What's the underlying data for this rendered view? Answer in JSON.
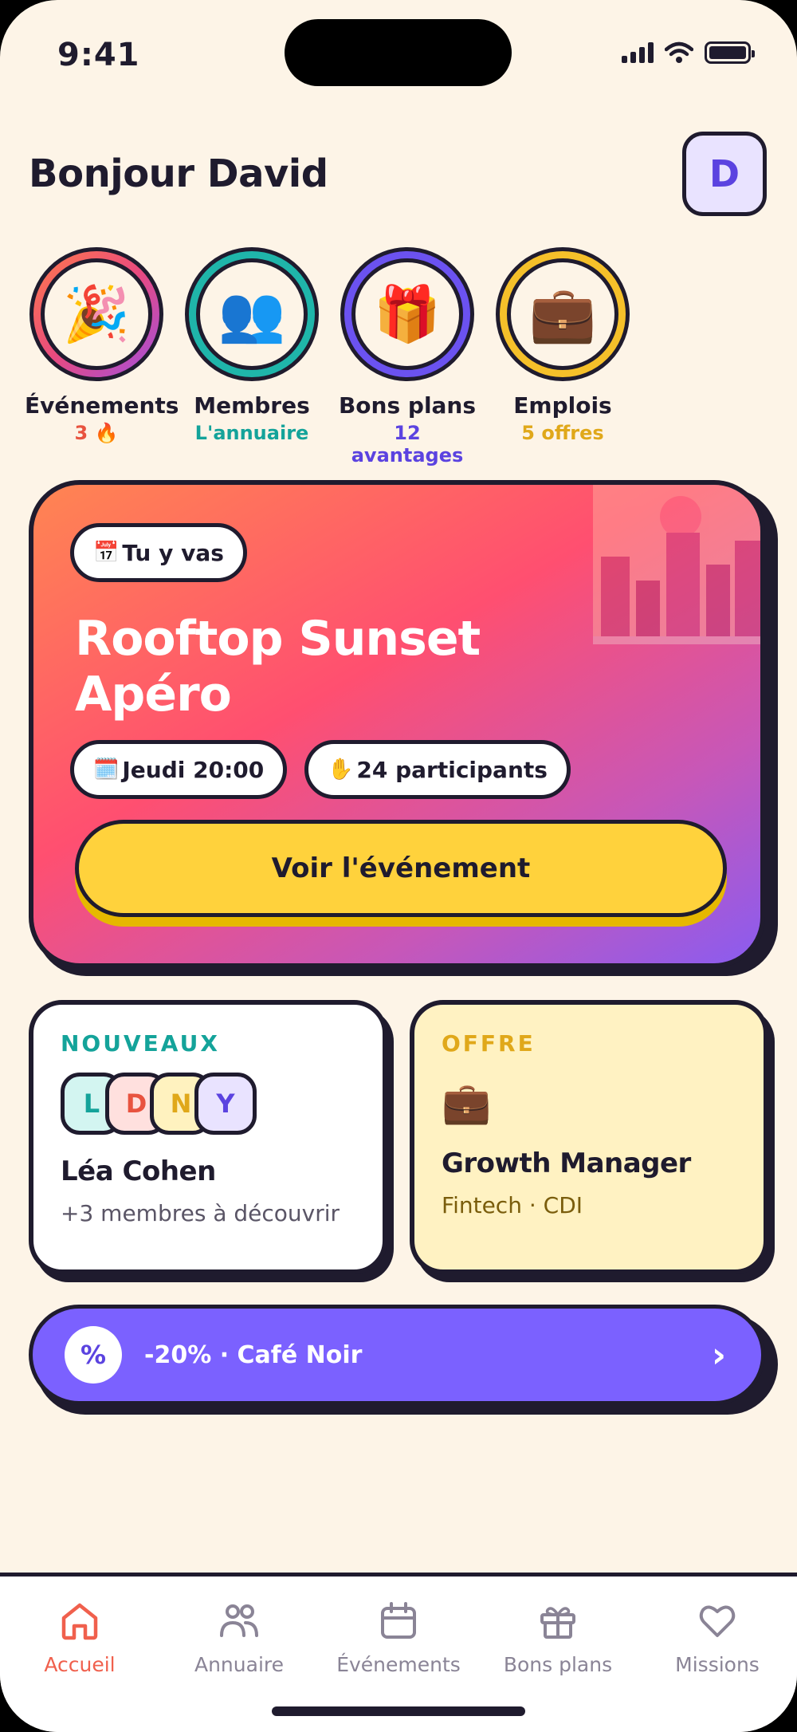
{
  "status": {
    "time": "9:41"
  },
  "header": {
    "greeting": "Bonjour David",
    "avatar_initial": "D"
  },
  "stories": [
    {
      "label": "Événements",
      "sub": "3 🔥",
      "icon": "party-popper",
      "emoji": "🎉",
      "color": "#e8533f"
    },
    {
      "label": "Membres",
      "sub": "L'annuaire",
      "icon": "people",
      "emoji": "👥",
      "color": "#14a39a"
    },
    {
      "label": "Bons plans",
      "sub": "12 avantages",
      "icon": "gift",
      "emoji": "🎁",
      "color": "#5b43e0"
    },
    {
      "label": "Emplois",
      "sub": "5 offres",
      "icon": "briefcase",
      "emoji": "💼",
      "color": "#e0a81a"
    }
  ],
  "hero": {
    "badge": "Tu y vas",
    "badge_emoji": "📅",
    "title_line1": "Rooftop Sunset",
    "title_line2": "Apéro",
    "date": "Jeudi 20:00",
    "date_emoji": "🗓️",
    "participants": "24 participants",
    "participants_emoji": "✋",
    "cta": "Voir l'événement"
  },
  "new_members": {
    "kicker": "NOUVEAUX",
    "initials": [
      "L",
      "D",
      "N",
      "Y"
    ],
    "name": "Léa Cohen",
    "sub": "+3 membres à découvrir"
  },
  "job_offer": {
    "kicker": "OFFRE",
    "emoji": "💼",
    "title": "Growth Manager",
    "sub": "Fintech · CDI"
  },
  "promo": {
    "badge": "%",
    "text": "-20% · Café Noir",
    "arrow": "›"
  },
  "tabbar": {
    "active": "Accueil",
    "items": [
      {
        "label": "Accueil",
        "icon": "home-icon"
      },
      {
        "label": "Annuaire",
        "icon": "people-icon"
      },
      {
        "label": "Événements",
        "icon": "calendar-icon"
      },
      {
        "label": "Bons plans",
        "icon": "gift-icon"
      },
      {
        "label": "Missions",
        "icon": "heart-icon"
      }
    ]
  },
  "colors": {
    "background": "#fdf4e7",
    "ink": "#1f1b2e",
    "accent_purple": "#7b61ff",
    "accent_yellow": "#ffd23c",
    "active_tab": "#f0604d"
  }
}
